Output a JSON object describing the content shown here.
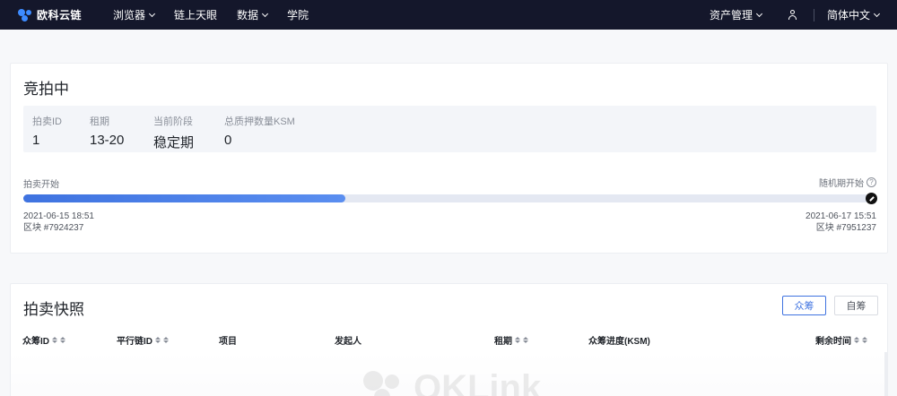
{
  "nav": {
    "brand": "欧科云链",
    "items": [
      {
        "label": "浏览器",
        "dropdown": true
      },
      {
        "label": "链上天眼",
        "dropdown": false
      },
      {
        "label": "数据",
        "dropdown": true
      },
      {
        "label": "学院",
        "dropdown": false
      }
    ],
    "asset_mgmt": "资产管理",
    "language": "简体中文",
    "colors": {
      "bg": "#14172b",
      "brand": "#3d8bff"
    }
  },
  "auction": {
    "title": "竞拍中",
    "info": [
      {
        "label": "拍卖ID",
        "value": "1"
      },
      {
        "label": "租期",
        "value": "13-20"
      },
      {
        "label": "当前阶段",
        "value": "稳定期"
      },
      {
        "label": "总质押数量KSM",
        "value": "0"
      }
    ],
    "progress": {
      "start_label": "拍卖开始",
      "end_label": "随机期开始",
      "fraction": 0.38,
      "start_time": "2021-06-15 18:51",
      "start_block": "区块 #7924237",
      "end_time": "2021-06-17 15:51",
      "end_block": "区块 #7951237",
      "help_icon": "question-circle-icon",
      "accent": "#3f73e0"
    }
  },
  "snapshot": {
    "title": "拍卖快照",
    "tabs": {
      "crowd": "众筹",
      "self": "自筹"
    },
    "columns": [
      {
        "label": "众筹ID",
        "sortable": true
      },
      {
        "label": "平行链ID",
        "sortable": true
      },
      {
        "label": "项目",
        "sortable": false
      },
      {
        "label": "发起人",
        "sortable": false
      },
      {
        "label": "租期",
        "sortable": true
      },
      {
        "label": "众筹进度(KSM)",
        "sortable": false
      },
      {
        "label": "剩余时间",
        "sortable": true
      }
    ],
    "watermark": "OKLink"
  }
}
